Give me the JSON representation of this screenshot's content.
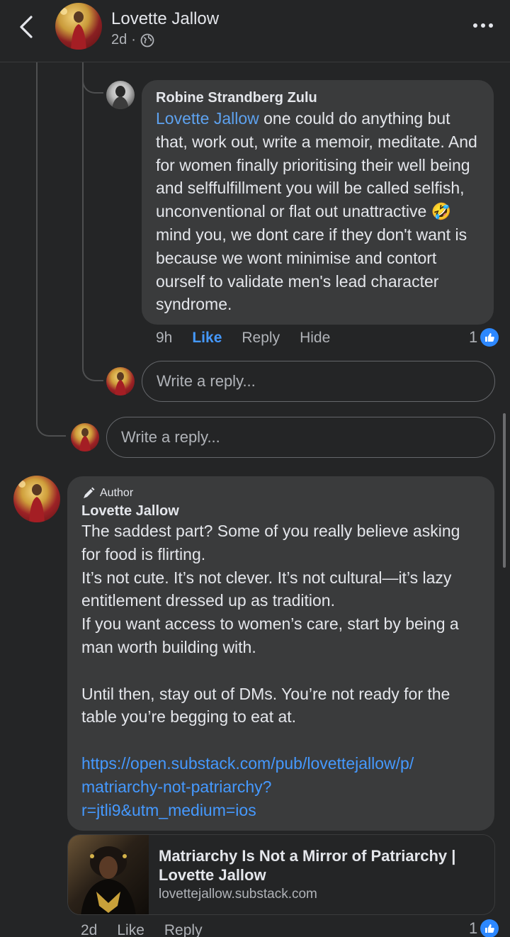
{
  "header": {
    "name": "Lovette Jallow",
    "time": "2d",
    "separator": "·"
  },
  "reply_comment": {
    "author": "Robine Strandberg Zulu",
    "mention": "Lovette Jallow",
    "text": " one could do anything but that, work out, write a memoir, meditate. And for women finally prioritising their well being and selffulfillment you will be called selfish, unconventional or flat out unattractive 🤣 mind you, we dont care if they don't want is because we wont minimise and contort ourself to validate men's lead character syndrome.",
    "time": "9h",
    "like_label": "Like",
    "reply_label": "Reply",
    "hide_label": "Hide",
    "reaction_count": "1"
  },
  "reply_input_nested": {
    "placeholder": "Write a reply..."
  },
  "reply_input_outer": {
    "placeholder": "Write a reply..."
  },
  "author_comment": {
    "badge": "Author",
    "author": "Lovette Jallow",
    "text": "The saddest part? Some of you really believe asking for food is flirting.\nIt’s not cute. It’s not clever. It’s not cultural—it’s lazy entitlement dressed up as tradition.\nIf you want access to women’s care, start by being a man worth building with.\n\nUntil then, stay out of DMs. You’re not ready for the table you’re begging to eat at.\n\n",
    "link_line_1": "https://open.substack.com/pub/lovettejallow/p/",
    "link_line_2": "matriarchy-not-patriarchy?",
    "link_line_3": "r=jtli9&utm_medium=ios",
    "time": "2d",
    "like_label": "Like",
    "reply_label": "Reply",
    "reaction_count": "1"
  },
  "link_card": {
    "title": "Matriarchy Is Not a Mirror of Patriarchy | Lovette Jallow",
    "domain": "lovettejallow.substack.com"
  },
  "icons": {
    "back": "chevron-left-icon",
    "globe": "globe-icon",
    "more": "more-horizontal-icon",
    "pen": "pen-icon",
    "like": "thumbs-up-icon"
  },
  "colors": {
    "background": "#242526",
    "bubble": "#3a3b3c",
    "link": "#4599ff",
    "like_badge": "#2d88ff"
  }
}
